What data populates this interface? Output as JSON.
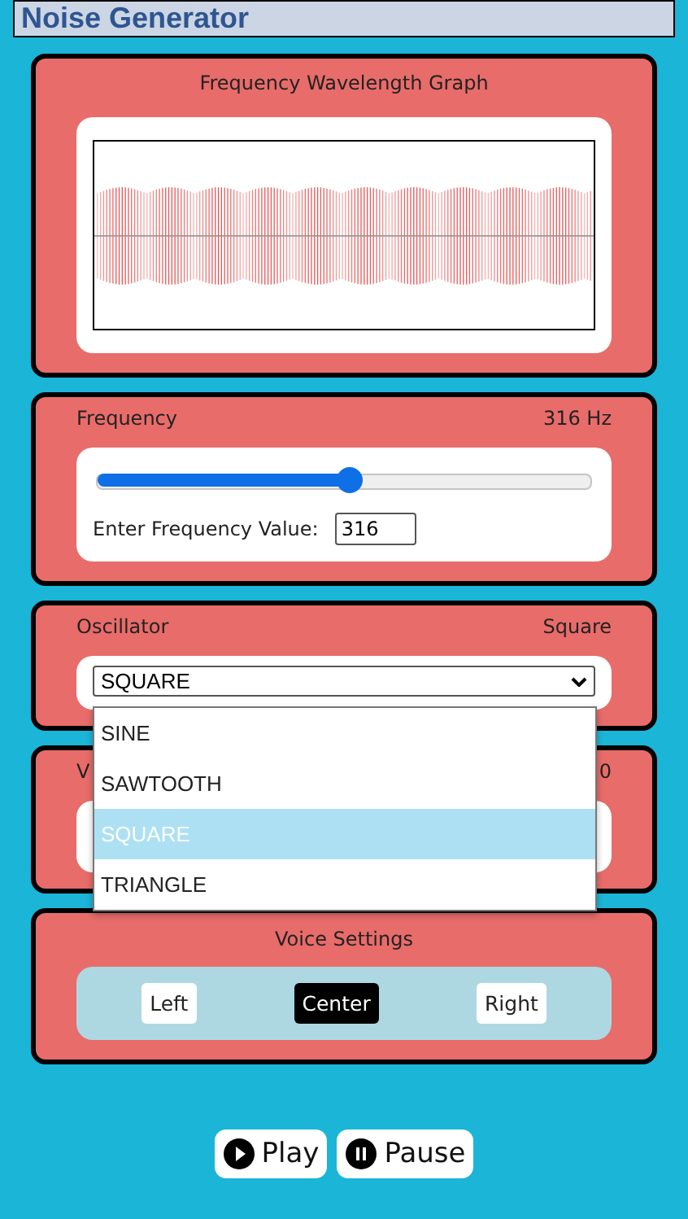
{
  "header": {
    "title": "Noise Generator"
  },
  "graph": {
    "title": "Frequency Wavelength Graph"
  },
  "frequency": {
    "label": "Frequency",
    "reading": "316 Hz",
    "level": 0.51,
    "input_label": "Enter Frequency Value:",
    "value": "316"
  },
  "oscillator": {
    "label": "Oscillator",
    "reading": "Square",
    "select_value": "SQUARE",
    "options": [
      {
        "label": "SINE",
        "selected": false
      },
      {
        "label": "SAWTOOTH",
        "selected": false
      },
      {
        "label": "SQUARE",
        "selected": true
      },
      {
        "label": "TRIANGLE",
        "selected": false
      }
    ]
  },
  "volume": {
    "label": "V",
    "reading": "0"
  },
  "voice": {
    "title": "Voice Settings",
    "options": [
      {
        "label": "Left",
        "selected": false
      },
      {
        "label": "Center",
        "selected": true
      },
      {
        "label": "Right",
        "selected": false
      }
    ]
  },
  "controls": [
    {
      "kind": "play",
      "label": "Play"
    },
    {
      "kind": "pause",
      "label": "Pause"
    }
  ]
}
